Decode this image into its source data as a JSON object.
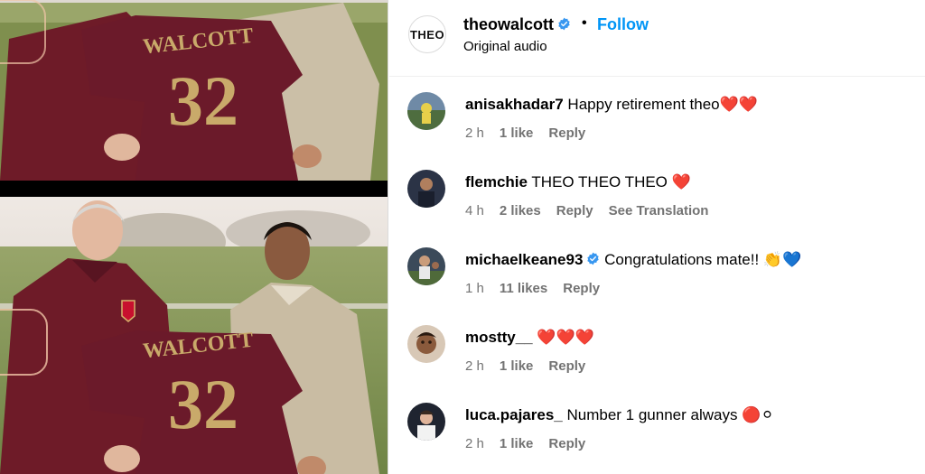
{
  "media": {
    "jersey_name": "WALCOTT",
    "jersey_number": "32"
  },
  "post": {
    "username": "theowalcott",
    "logo_text": "THEO",
    "separator": "•",
    "follow_label": "Follow",
    "audio_label": "Original audio"
  },
  "comments": [
    {
      "username": "anisakhadar7",
      "verified": false,
      "text": "Happy retirement theo❤️❤️",
      "time": "2 h",
      "likes": "1 like",
      "reply": "Reply",
      "extra": ""
    },
    {
      "username": "flemchie",
      "verified": false,
      "text": "THEO THEO THEO ❤️",
      "time": "4 h",
      "likes": "2 likes",
      "reply": "Reply",
      "extra": "See Translation"
    },
    {
      "username": "michaelkeane93",
      "verified": true,
      "text": "Congratulations mate!! 👏💙",
      "time": "1 h",
      "likes": "11 likes",
      "reply": "Reply",
      "extra": ""
    },
    {
      "username": "mostty__",
      "verified": false,
      "text": "❤️❤️❤️",
      "time": "2 h",
      "likes": "1 like",
      "reply": "Reply",
      "extra": ""
    },
    {
      "username": "luca.pajares_",
      "verified": false,
      "text": "Number 1 gunner always 🔴⚪",
      "time": "2 h",
      "likes": "1 like",
      "reply": "Reply",
      "extra": ""
    }
  ],
  "colors": {
    "accent": "#0095f6",
    "meta": "#737373",
    "verified": "#3897f0",
    "jersey": "#6b1a2a"
  }
}
